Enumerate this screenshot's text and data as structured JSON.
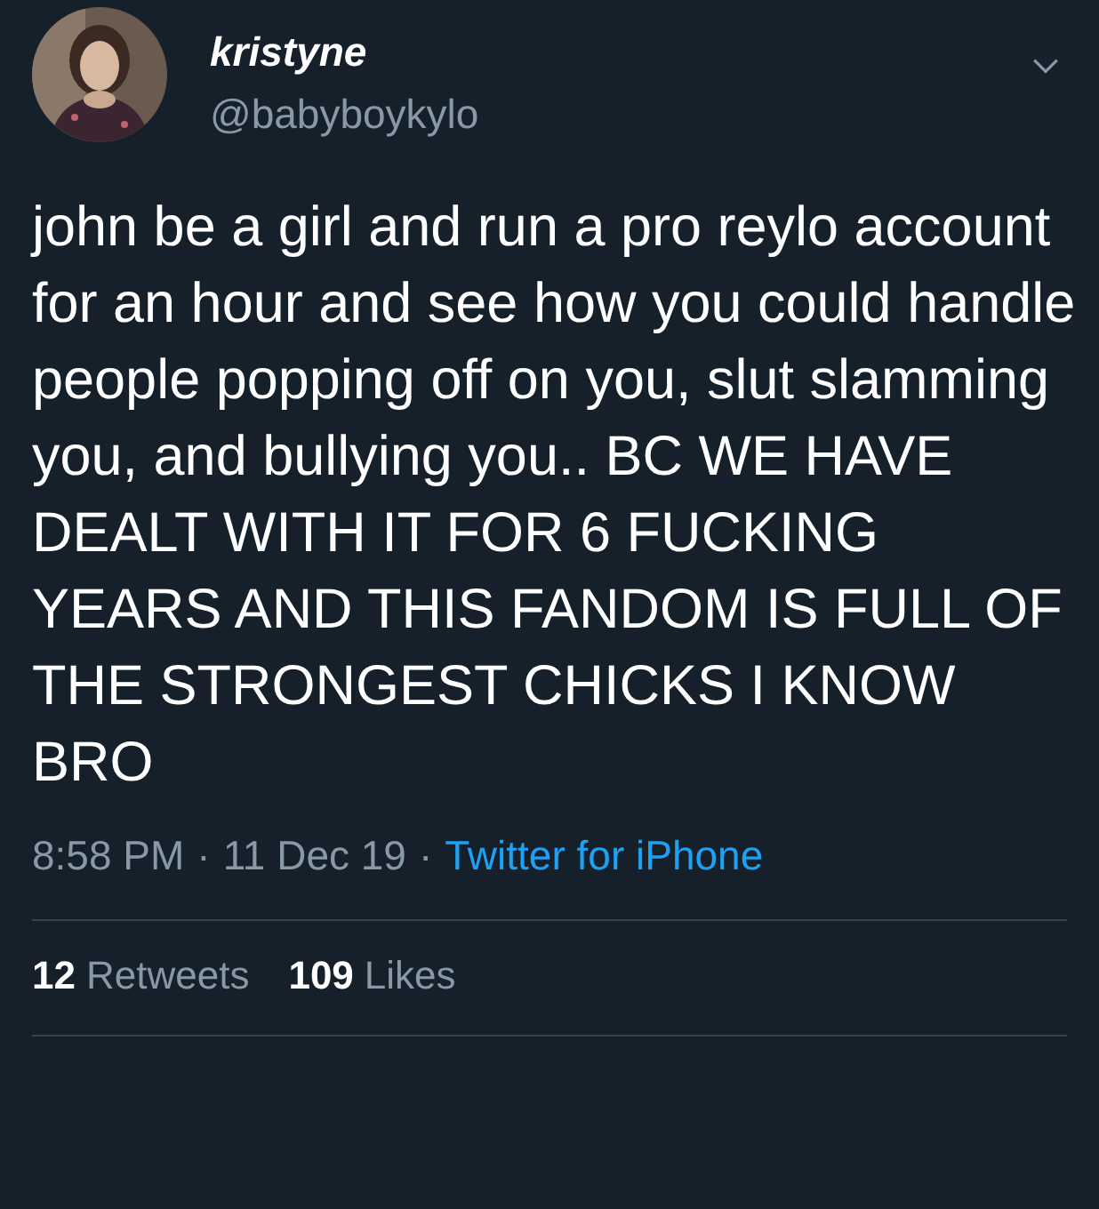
{
  "author": {
    "name": "kristyne",
    "handle": "@babyboykylo"
  },
  "text": "john be a girl and run a pro reylo account for an hour and see how you could handle people popping off on you, slut slamming you, and bullying you.. BC WE HAVE DEALT WITH IT FOR 6 FUCKING YEARS AND THIS FANDOM IS FULL OF THE STRONGEST CHICKS I KNOW BRO",
  "meta": {
    "time": "8:58 PM",
    "separator": "·",
    "date": "11 Dec 19",
    "separator_2": "·",
    "source": "Twitter for iPhone"
  },
  "stats": [
    {
      "count": "12",
      "label": "Retweets"
    },
    {
      "count": "109",
      "label": "Likes"
    }
  ]
}
